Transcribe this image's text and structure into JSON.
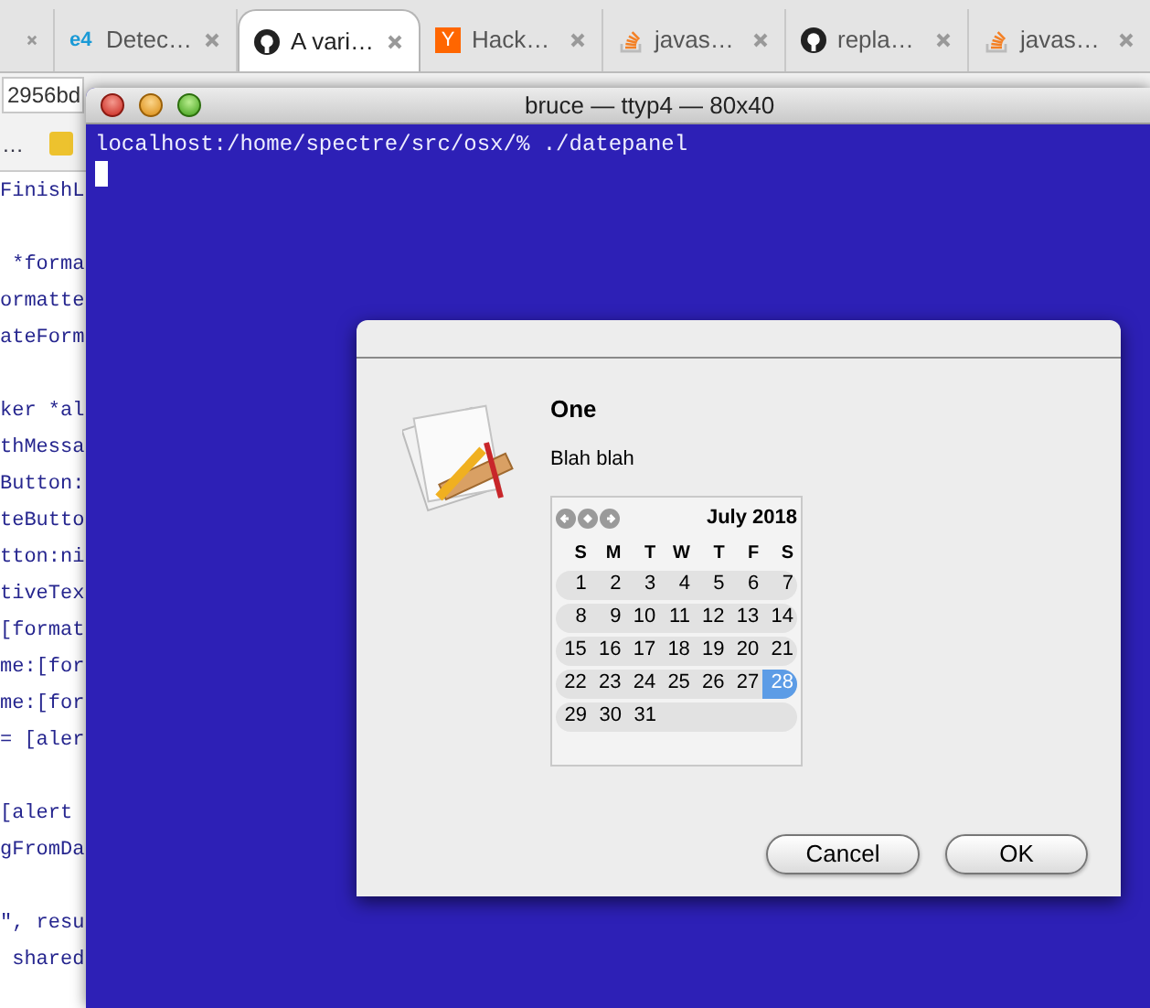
{
  "browser": {
    "tabs": [
      {
        "selected": false
      },
      {
        "label": "Detec…",
        "icon_text": "e4",
        "selected": false
      },
      {
        "label": "A vari…",
        "selected": true
      },
      {
        "label": "Hack…",
        "icon_text": "Y",
        "selected": false
      },
      {
        "label": "javas…",
        "selected": false
      },
      {
        "label": "repla…",
        "selected": false
      },
      {
        "label": "javas…",
        "selected": false
      }
    ],
    "address": "2956bd",
    "bookmarks": [
      {
        "label": "…"
      }
    ],
    "code_lines": [
      {
        "text": "FinishL"
      },
      {
        "text": " *forma",
        "spaced": true
      },
      {
        "text": "ormatte"
      },
      {
        "text": "ateForm"
      },
      {
        "text": "ker *al",
        "spaced": true
      },
      {
        "text": "thMessa"
      },
      {
        "text": "Button:"
      },
      {
        "text": "teButto"
      },
      {
        "text": "tton:ni"
      },
      {
        "text": "tiveTex"
      },
      {
        "text": "[format"
      },
      {
        "text": "me:[for"
      },
      {
        "text": "me:[for"
      },
      {
        "text": "= [aler"
      },
      {
        "text": "[alert",
        "spaced": true
      },
      {
        "text": "gFromDa"
      },
      {
        "text": "\", resu",
        "spaced": true
      },
      {
        "text": " shared"
      }
    ]
  },
  "terminal": {
    "title": "bruce — ttyp4 — 80x40",
    "prompt": "localhost:/home/spectre/src/osx/% ./datepanel"
  },
  "dialog": {
    "title": "One",
    "message": "Blah blah",
    "calendar": {
      "month": "July 2018",
      "weekdays": [
        "S",
        "M",
        "T",
        "W",
        "T",
        "F",
        "S"
      ],
      "weeks": [
        [
          {
            "day": "1",
            "selected": false
          },
          {
            "day": "2",
            "selected": false
          },
          {
            "day": "3",
            "selected": false
          },
          {
            "day": "4",
            "selected": false
          },
          {
            "day": "5",
            "selected": false
          },
          {
            "day": "6",
            "selected": false
          },
          {
            "day": "7",
            "selected": false
          }
        ],
        [
          {
            "day": "8",
            "selected": false
          },
          {
            "day": "9",
            "selected": false
          },
          {
            "day": "10",
            "selected": false
          },
          {
            "day": "11",
            "selected": false
          },
          {
            "day": "12",
            "selected": false
          },
          {
            "day": "13",
            "selected": false
          },
          {
            "day": "14",
            "selected": false
          }
        ],
        [
          {
            "day": "15",
            "selected": false
          },
          {
            "day": "16",
            "selected": false
          },
          {
            "day": "17",
            "selected": false
          },
          {
            "day": "18",
            "selected": false
          },
          {
            "day": "19",
            "selected": false
          },
          {
            "day": "20",
            "selected": false
          },
          {
            "day": "21",
            "selected": false
          }
        ],
        [
          {
            "day": "22",
            "selected": false
          },
          {
            "day": "23",
            "selected": false
          },
          {
            "day": "24",
            "selected": false
          },
          {
            "day": "25",
            "selected": false
          },
          {
            "day": "26",
            "selected": false
          },
          {
            "day": "27",
            "selected": false
          },
          {
            "day": "28",
            "selected": true
          }
        ],
        [
          {
            "day": "29",
            "selected": false
          },
          {
            "day": "30",
            "selected": false
          },
          {
            "day": "31",
            "selected": false
          }
        ]
      ]
    },
    "buttons": [
      {
        "label": "Cancel",
        "kind": "normal"
      },
      {
        "label": "OK",
        "kind": "normal"
      }
    ]
  }
}
